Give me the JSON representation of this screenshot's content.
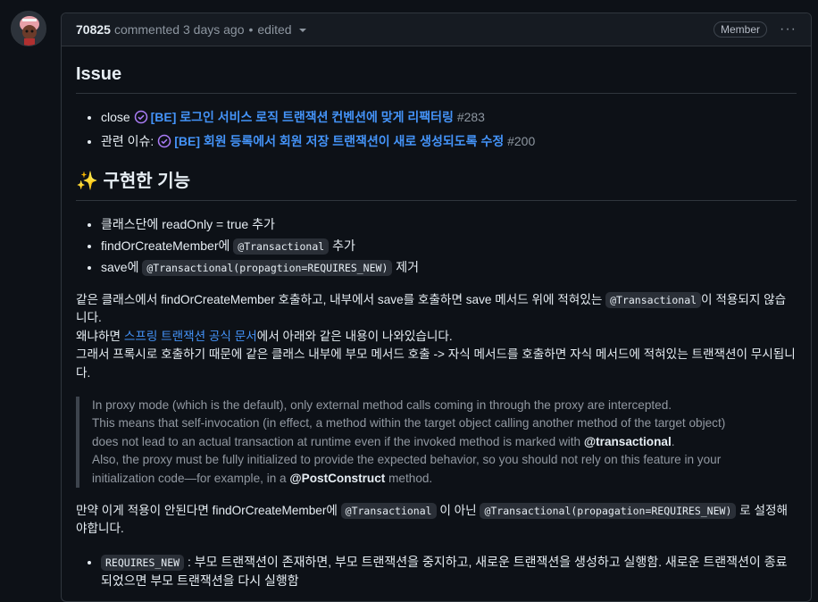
{
  "comment": {
    "author": "70825",
    "action": "commented",
    "time": "3 days ago",
    "edited": "edited",
    "badge": "Member",
    "menu": "···"
  },
  "issue_section": {
    "title": "Issue",
    "items": [
      {
        "prefix": "close",
        "link": "[BE] 로그인 서비스 로직 트랜잭션 컨벤션에 맞게 리팩터링",
        "num": "#283"
      },
      {
        "prefix": "관련 이슈:",
        "link": "[BE] 회원 등록에서 회원 저장 트랜잭션이 새로 생성되도록 수정",
        "num": "#200"
      }
    ]
  },
  "feature_section": {
    "sparkle": "✨",
    "title": "구현한 기능",
    "items": [
      {
        "text": "클래스단에 readOnly = true 추가"
      },
      {
        "pre": "findOrCreateMember에",
        "code": "@Transactional",
        "post": "추가"
      },
      {
        "pre": "save에",
        "code": "@Transactional(propagtion=REQUIRES_NEW)",
        "post": "제거"
      }
    ]
  },
  "para1": {
    "pre": "같은 클래스에서 findOrCreateMember 호출하고, 내부에서 save를 호출하면 save 메서드 위에 적혀있는",
    "code": "@Transactional",
    "post": "이 적용되지 않습니다.",
    "line2_pre": "왜냐하면",
    "line2_link": "스프링 트랜잭션 공식 문서",
    "line2_post": "에서 아래와 같은 내용이 나와있습니다.",
    "line3": "그래서 프록시로 호출하기 때문에 같은 클래스 내부에 부모 메서드 호출 -> 자식 메서드를 호출하면 자식 메서드에 적혀있는 트랜잭션이 무시됩니다."
  },
  "quote": {
    "l1": "In proxy mode (which is the default), only external method calls coming in through the proxy are intercepted.",
    "l2": "This means that self-invocation (in effect, a method within the target object calling another method of the target object)",
    "l3_pre": "does not lead to an actual transaction at runtime even if the invoked method is marked with",
    "l3_bold": "@transactional",
    "l3_post": ".",
    "l4": "Also, the proxy must be fully initialized to provide the expected behavior, so you should not rely on this feature in your",
    "l5_pre": "initialization code—for example, in a",
    "l5_bold": "@PostConstruct",
    "l5_post": "method."
  },
  "para2": {
    "pre": "만약 이게 적용이 안된다면 findOrCreateMember에",
    "code1": "@Transactional",
    "mid": "이 아닌",
    "code2": "@Transactional(propagation=REQUIRES_NEW)",
    "post": "로 설정해야합니다."
  },
  "list2": {
    "code": "REQUIRES_NEW",
    "text": ": 부모 트랜잭션이 존재하면, 부모 트랜잭션을 중지하고, 새로운 트랜잭션을 생성하고 실행함. 새로운 트랜잭션이 종료되었으면 부모 트랜잭션을 다시 실행함"
  }
}
